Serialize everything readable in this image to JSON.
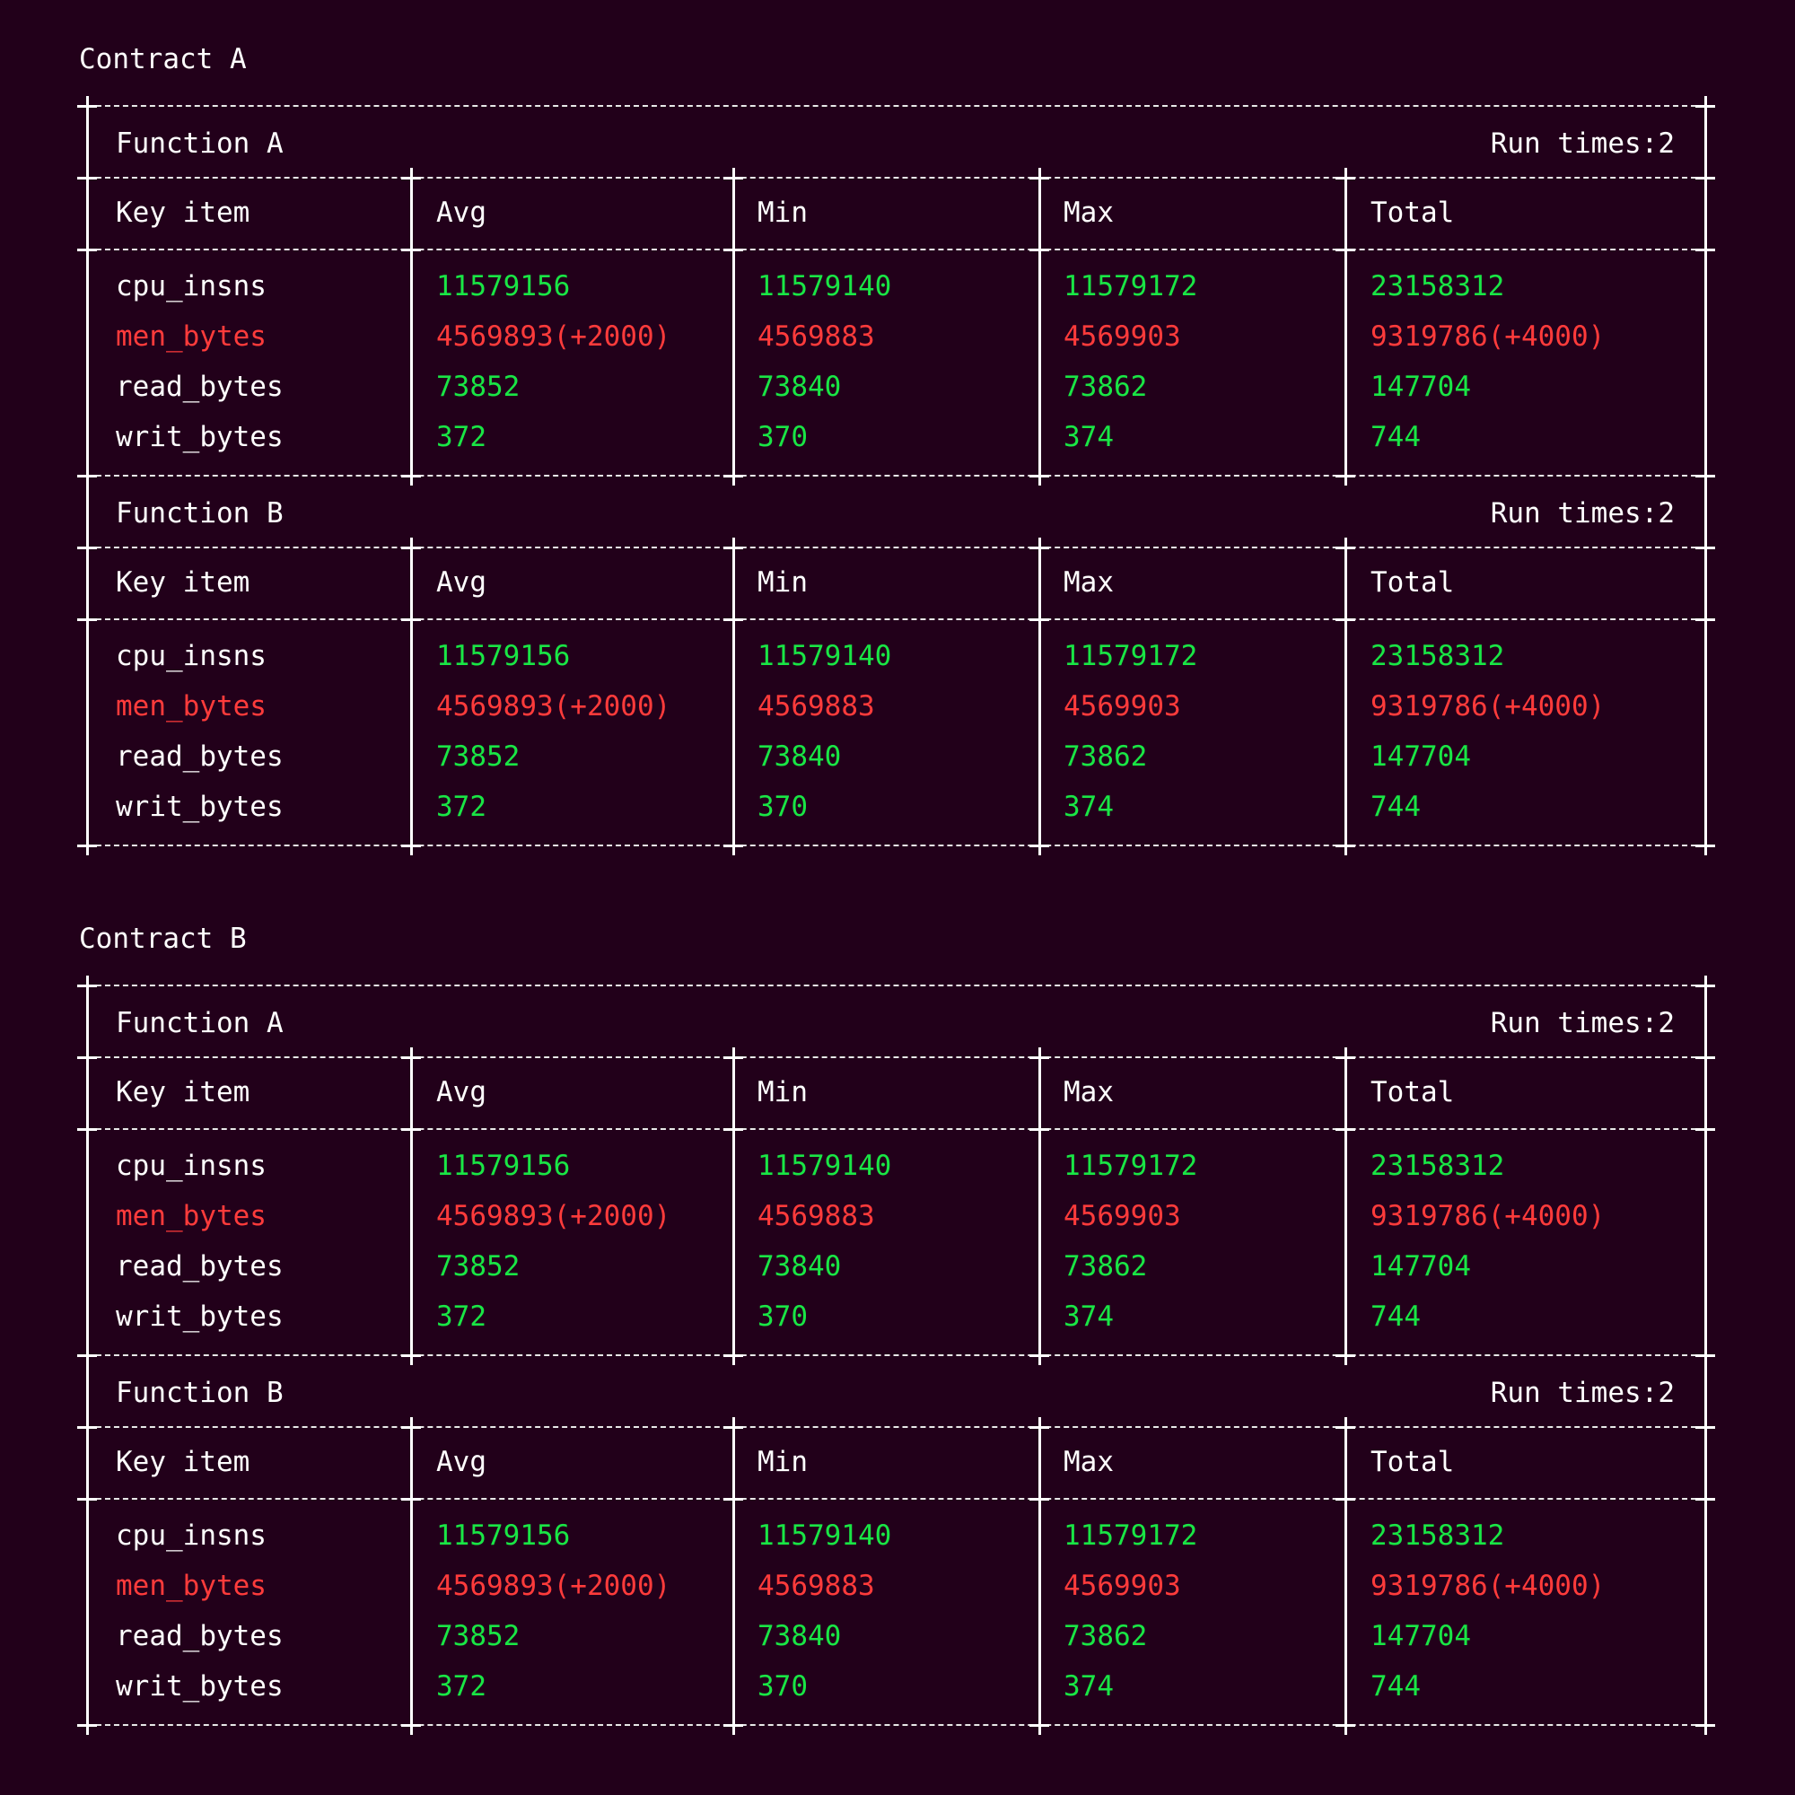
{
  "colors": {
    "background": "#22001a",
    "text": "#ffffff",
    "good": "#19e645",
    "bad": "#ff3b3b"
  },
  "contracts": [
    {
      "title": "Contract A",
      "functions": [
        {
          "name": "Function A",
          "run_times": "Run times:2",
          "headers": [
            "Key item",
            "Avg",
            "Min",
            "Max",
            "Total"
          ],
          "rows": [
            {
              "key": "cpu_insns",
              "status": "good",
              "values": [
                "11579156",
                "11579140",
                "11579172",
                "23158312"
              ]
            },
            {
              "key": "men_bytes",
              "status": "bad",
              "values": [
                "4569893(+2000)",
                "4569883",
                "4569903",
                "9319786(+4000)"
              ]
            },
            {
              "key": "read_bytes",
              "status": "good",
              "values": [
                "73852",
                "73840",
                "73862",
                "147704"
              ]
            },
            {
              "key": "writ_bytes",
              "status": "good",
              "values": [
                "372",
                "370",
                "374",
                "744"
              ]
            }
          ]
        },
        {
          "name": "Function B",
          "run_times": "Run times:2",
          "headers": [
            "Key item",
            "Avg",
            "Min",
            "Max",
            "Total"
          ],
          "rows": [
            {
              "key": "cpu_insns",
              "status": "good",
              "values": [
                "11579156",
                "11579140",
                "11579172",
                "23158312"
              ]
            },
            {
              "key": "men_bytes",
              "status": "bad",
              "values": [
                "4569893(+2000)",
                "4569883",
                "4569903",
                "9319786(+4000)"
              ]
            },
            {
              "key": "read_bytes",
              "status": "good",
              "values": [
                "73852",
                "73840",
                "73862",
                "147704"
              ]
            },
            {
              "key": "writ_bytes",
              "status": "good",
              "values": [
                "372",
                "370",
                "374",
                "744"
              ]
            }
          ]
        }
      ]
    },
    {
      "title": "Contract B",
      "functions": [
        {
          "name": "Function A",
          "run_times": "Run times:2",
          "headers": [
            "Key item",
            "Avg",
            "Min",
            "Max",
            "Total"
          ],
          "rows": [
            {
              "key": "cpu_insns",
              "status": "good",
              "values": [
                "11579156",
                "11579140",
                "11579172",
                "23158312"
              ]
            },
            {
              "key": "men_bytes",
              "status": "bad",
              "values": [
                "4569893(+2000)",
                "4569883",
                "4569903",
                "9319786(+4000)"
              ]
            },
            {
              "key": "read_bytes",
              "status": "good",
              "values": [
                "73852",
                "73840",
                "73862",
                "147704"
              ]
            },
            {
              "key": "writ_bytes",
              "status": "good",
              "values": [
                "372",
                "370",
                "374",
                "744"
              ]
            }
          ]
        },
        {
          "name": "Function B",
          "run_times": "Run times:2",
          "headers": [
            "Key item",
            "Avg",
            "Min",
            "Max",
            "Total"
          ],
          "rows": [
            {
              "key": "cpu_insns",
              "status": "good",
              "values": [
                "11579156",
                "11579140",
                "11579172",
                "23158312"
              ]
            },
            {
              "key": "men_bytes",
              "status": "bad",
              "values": [
                "4569893(+2000)",
                "4569883",
                "4569903",
                "9319786(+4000)"
              ]
            },
            {
              "key": "read_bytes",
              "status": "good",
              "values": [
                "73852",
                "73840",
                "73862",
                "147704"
              ]
            },
            {
              "key": "writ_bytes",
              "status": "good",
              "values": [
                "372",
                "370",
                "374",
                "744"
              ]
            }
          ]
        }
      ]
    }
  ]
}
